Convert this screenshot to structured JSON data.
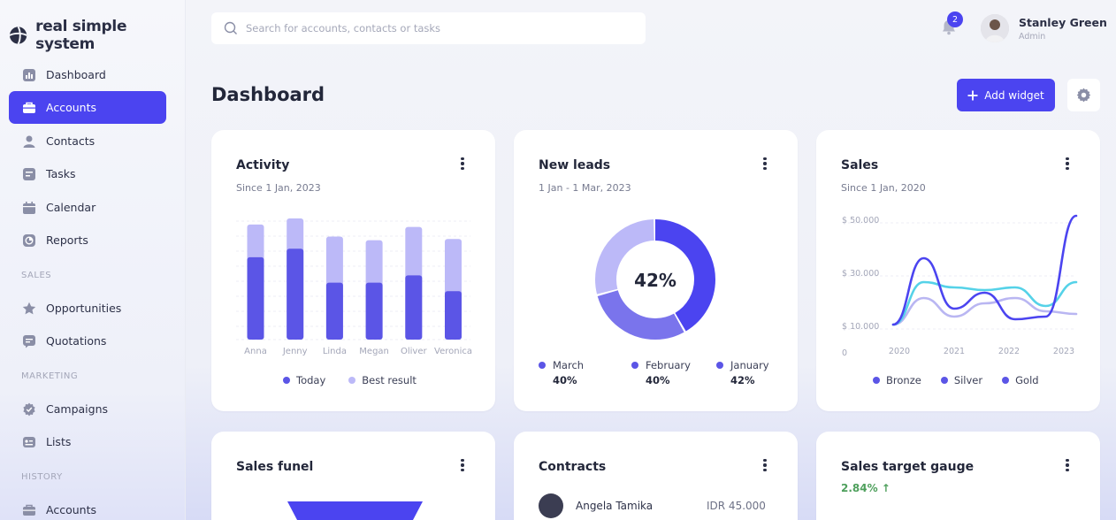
{
  "app": {
    "name": "real simple system"
  },
  "sidebar": {
    "items": [
      {
        "label": "Dashboard",
        "icon": "bar-chart-icon"
      },
      {
        "label": "Accounts",
        "icon": "briefcase-icon",
        "active": true
      },
      {
        "label": "Contacts",
        "icon": "user-icon"
      },
      {
        "label": "Tasks",
        "icon": "tasks-icon"
      },
      {
        "label": "Calendar",
        "icon": "calendar-icon"
      },
      {
        "label": "Reports",
        "icon": "pie-icon"
      }
    ],
    "sections": {
      "sales": {
        "title": "SALES",
        "items": [
          {
            "label": "Opportunities",
            "icon": "star-icon"
          },
          {
            "label": "Quotations",
            "icon": "quote-icon"
          }
        ]
      },
      "marketing": {
        "title": "MARKETING",
        "items": [
          {
            "label": "Campaigns",
            "icon": "gear-badge-icon"
          },
          {
            "label": "Lists",
            "icon": "list-icon"
          }
        ]
      },
      "history": {
        "title": "HISTORY",
        "items": [
          {
            "label": "Accounts",
            "icon": "briefcase-icon"
          }
        ]
      }
    }
  },
  "search": {
    "placeholder": "Search for accounts, contacts or tasks"
  },
  "notifications": {
    "count": "2"
  },
  "user": {
    "name": "Stanley Green",
    "role": "Admin"
  },
  "page": {
    "title": "Dashboard",
    "add_widget_label": "Add widget"
  },
  "activity": {
    "title": "Activity",
    "subtitle": "Since 1 Jan, 2023",
    "legend": [
      "Today",
      "Best result"
    ]
  },
  "leads": {
    "title": "New leads",
    "subtitle": "1 Jan - 1 Mar, 2023",
    "center": "42%",
    "legend": [
      {
        "name": "March",
        "value": "40%"
      },
      {
        "name": "February",
        "value": "40%"
      },
      {
        "name": "January",
        "value": "42%"
      }
    ]
  },
  "sales": {
    "title": "Sales",
    "subtitle": "Since 1 Jan, 2020",
    "legend": [
      "Bronze",
      "Silver",
      "Gold"
    ]
  },
  "funnel": {
    "title": "Sales funel"
  },
  "contracts": {
    "title": "Contracts",
    "rows": [
      {
        "name": "Angela Tamika",
        "amount": "IDR 45.000"
      }
    ]
  },
  "gauge": {
    "title": "Sales target gauge",
    "change": "2.84% ↑"
  },
  "colors": {
    "accent": "#4b44f0",
    "light": "#bcb9f8",
    "cyan": "#55d2e8",
    "lavender": "#b9b6f2"
  },
  "chart_data": [
    {
      "type": "bar",
      "categories": [
        "Anna",
        "Jenny",
        "Linda",
        "Megan",
        "Oliver",
        "Veronica"
      ],
      "series": [
        {
          "name": "Today",
          "values": [
            68,
            75,
            47,
            47,
            53,
            40
          ]
        },
        {
          "name": "Best result",
          "values": [
            95,
            100,
            85,
            82,
            93,
            83
          ]
        }
      ],
      "ylim": [
        0,
        100
      ]
    },
    {
      "type": "pie",
      "donut": true,
      "slices": [
        {
          "name": "January",
          "value": 42
        },
        {
          "name": "February",
          "value": 40
        },
        {
          "name": "March",
          "value": 40
        }
      ]
    },
    {
      "type": "line",
      "x": [
        2020,
        2021,
        2022,
        2023
      ],
      "y_ticks": [
        "$ 50.000",
        "$ 30.000",
        "$ 10.000",
        "0"
      ],
      "ylim": [
        0,
        50000
      ],
      "series": [
        {
          "name": "Bronze",
          "values": [
            10000,
            20000,
            13000,
            18000,
            20000,
            15000,
            14000
          ]
        },
        {
          "name": "Silver",
          "values": [
            10000,
            26000,
            24000,
            23000,
            24000,
            17000,
            26000
          ]
        },
        {
          "name": "Gold",
          "values": [
            10000,
            35000,
            16000,
            22000,
            12000,
            13000,
            51000
          ]
        }
      ]
    }
  ]
}
